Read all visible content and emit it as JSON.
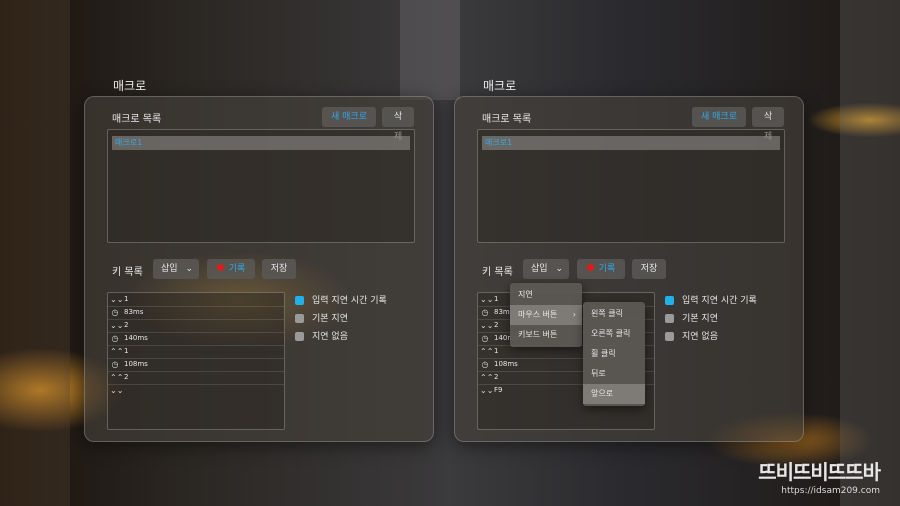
{
  "panels": [
    {
      "window_title": "매크로",
      "macro_list_label": "매크로 목록",
      "new_macro_label": "새 매크로",
      "delete_label": "삭제",
      "macros": [
        "매크로1"
      ],
      "key_list_label": "키 목록",
      "insert_label": "삽입",
      "record_label": "기록",
      "save_label": "저장"
    },
    {
      "window_title": "매크로",
      "macro_list_label": "매크로 목록",
      "new_macro_label": "새 매크로",
      "delete_label": "삭제",
      "macros": [
        "매크로1"
      ],
      "key_list_label": "키 목록",
      "insert_label": "삽입",
      "record_label": "기록",
      "save_label": "저장"
    }
  ],
  "left_keys": [
    {
      "icon": "key-down-icon",
      "text": "1"
    },
    {
      "icon": "clock-icon",
      "text": "83ms"
    },
    {
      "icon": "key-down-icon",
      "text": "2"
    },
    {
      "icon": "clock-icon",
      "text": "140ms"
    },
    {
      "icon": "key-up-icon",
      "text": "1"
    },
    {
      "icon": "clock-icon",
      "text": "108ms"
    },
    {
      "icon": "key-up-icon",
      "text": "2"
    },
    {
      "icon": "key-down-icon",
      "text": ""
    }
  ],
  "right_keys": [
    {
      "icon": "key-down-icon",
      "text": "1"
    },
    {
      "icon": "clock-icon",
      "text": "83ms"
    },
    {
      "icon": "key-down-icon",
      "text": "2"
    },
    {
      "icon": "clock-icon",
      "text": "140ms"
    },
    {
      "icon": "key-up-icon",
      "text": "1"
    },
    {
      "icon": "clock-icon",
      "text": "108ms"
    },
    {
      "icon": "key-up-icon",
      "text": "2"
    },
    {
      "icon": "key-down-icon",
      "text": "F9"
    }
  ],
  "options": [
    {
      "label": "입력 지연 시간 기록",
      "checked": true
    },
    {
      "label": "기본 지연",
      "checked": false
    },
    {
      "label": "지연 없음",
      "checked": false
    }
  ],
  "insert_menu": [
    "지연",
    "마우스 버튼",
    "키보드 버튼"
  ],
  "mouse_submenu": [
    "왼쪽 클릭",
    "오른쪽 클릭",
    "휠 클릭",
    "뒤로",
    "앞으로"
  ],
  "watermark": {
    "logo": "뜨비뜨비뜨뜨바",
    "url": "https://idsam209.com"
  },
  "colors": {
    "accent": "#2ea8e6",
    "record": "#e01b1b",
    "checked": "#22b0e8"
  }
}
